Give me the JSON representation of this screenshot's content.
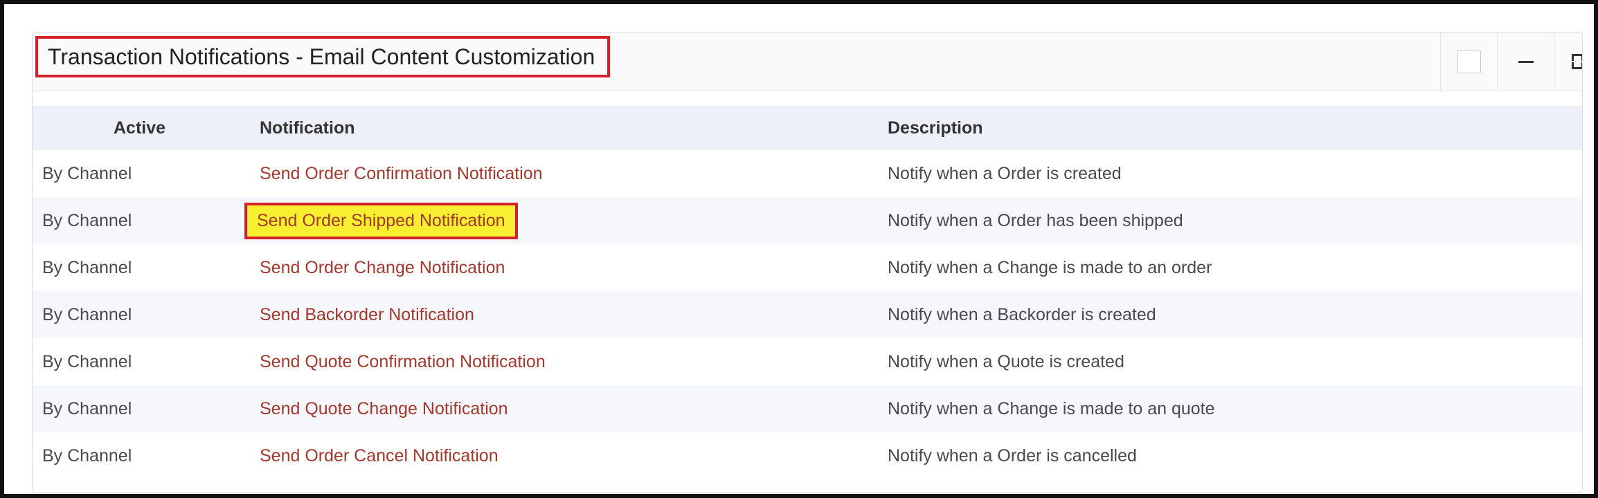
{
  "panel": {
    "title": "Transaction Notifications - Email Content Customization",
    "header_icons": [
      "checkbox-icon",
      "minimize-icon",
      "expand-icon"
    ]
  },
  "table": {
    "columns": [
      "Active",
      "Notification",
      "Description"
    ],
    "rows": [
      {
        "active": "By Channel",
        "notification": "Send Order Confirmation Notification",
        "description": "Notify when a Order is created"
      },
      {
        "active": "By Channel",
        "notification": "Send Order Shipped Notification",
        "description": "Notify when a Order has been shipped"
      },
      {
        "active": "By Channel",
        "notification": "Send Order Change Notification",
        "description": "Notify when a Change is made to an order"
      },
      {
        "active": "By Channel",
        "notification": "Send Backorder Notification",
        "description": "Notify when a Backorder is created"
      },
      {
        "active": "By Channel",
        "notification": "Send Quote Confirmation Notification",
        "description": "Notify when a Quote is created"
      },
      {
        "active": "By Channel",
        "notification": "Send Quote Change Notification",
        "description": "Notify when a Change is made to an quote"
      },
      {
        "active": "By Channel",
        "notification": "Send Order Cancel Notification",
        "description": "Notify when a Order is cancelled"
      }
    ]
  },
  "colors": {
    "link": "#a5372b",
    "highlight": "#f7ef2f",
    "annotation_border": "#d4202a",
    "header_bg": "#eef0f9"
  }
}
